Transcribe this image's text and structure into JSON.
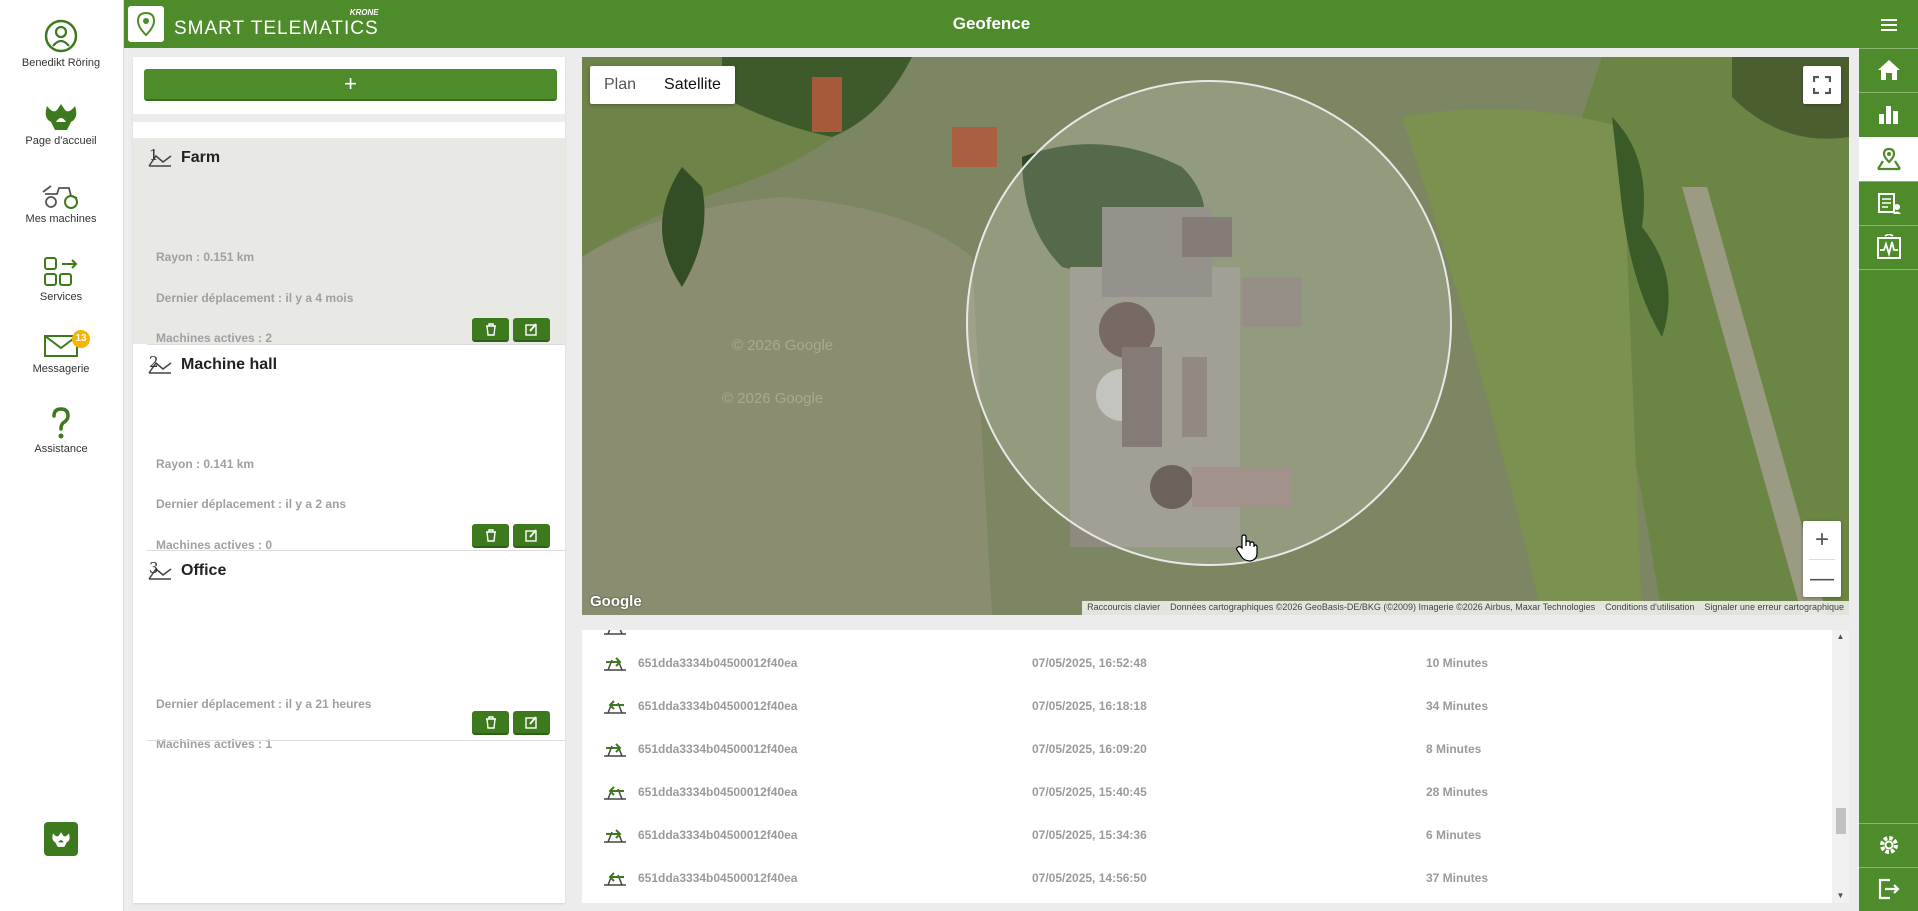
{
  "app": {
    "brand": "SMART TELEMATICS",
    "brand_maker": "KRONE",
    "page_title": "Geofence"
  },
  "sidebar": {
    "items": [
      {
        "label": "Benedikt Röring",
        "icon": "user-icon"
      },
      {
        "label": "Page d'accueil",
        "icon": "krone-logo-icon"
      },
      {
        "label": "Mes machines",
        "icon": "tractor-icon"
      },
      {
        "label": "Services",
        "icon": "services-icon"
      },
      {
        "label": "Messagerie",
        "icon": "envelope-icon",
        "badge": "13"
      },
      {
        "label": "Assistance",
        "icon": "question-icon"
      }
    ]
  },
  "rightbar": {
    "items": [
      "menu-icon",
      "home-icon",
      "chart-icon",
      "geofence-icon",
      "report-icon",
      "telemetry-icon",
      "gear-icon",
      "logout-icon"
    ],
    "active": "geofence-icon"
  },
  "geofences": {
    "add_label": "+",
    "items": [
      {
        "num": "1",
        "name": "Farm",
        "radius": "Rayon : 0.151 km",
        "last_move": "Dernier déplacement : il y a 4 mois",
        "active": "Machines actives : 2",
        "selected": true
      },
      {
        "num": "2",
        "name": "Machine hall",
        "radius": "Rayon : 0.141 km",
        "last_move": "Dernier déplacement : il y a 2 ans",
        "active": "Machines actives : 0",
        "selected": false
      },
      {
        "num": "3",
        "name": "Office",
        "radius": "",
        "last_move": "Dernier déplacement : il y a 21 heures",
        "active": "Machines actives : 1",
        "selected": false
      }
    ]
  },
  "map": {
    "type_plan": "Plan",
    "type_satellite": "Satellite",
    "selected_type": "Satellite",
    "zoom_in": "+",
    "zoom_out": "—",
    "logo": "Google",
    "watermark": "© 2026 Google",
    "attribution": {
      "shortcuts": "Raccourcis clavier",
      "data": "Données cartographiques ©2026 GeoBasis-DE/BKG (©2009) Imagerie ©2026 Airbus, Maxar Technologies",
      "terms": "Conditions d'utilisation",
      "report": "Signaler une erreur cartographique"
    }
  },
  "log": {
    "rows": [
      {
        "id": "651dda3334b04500012f40ea",
        "date": "07/05/2025, 16:52:48",
        "duration": "10 Minutes",
        "direction": "exit"
      },
      {
        "id": "651dda3334b04500012f40ea",
        "date": "07/05/2025, 16:18:18",
        "duration": "34 Minutes",
        "direction": "enter"
      },
      {
        "id": "651dda3334b04500012f40ea",
        "date": "07/05/2025, 16:09:20",
        "duration": "8 Minutes",
        "direction": "exit"
      },
      {
        "id": "651dda3334b04500012f40ea",
        "date": "07/05/2025, 15:40:45",
        "duration": "28 Minutes",
        "direction": "enter"
      },
      {
        "id": "651dda3334b04500012f40ea",
        "date": "07/05/2025, 15:34:36",
        "duration": "6 Minutes",
        "direction": "exit"
      },
      {
        "id": "651dda3334b04500012f40ea",
        "date": "07/05/2025, 14:56:50",
        "duration": "37 Minutes",
        "direction": "enter"
      }
    ]
  },
  "colors": {
    "brand_green": "#4e8b2a",
    "dark_green": "#3d7a1e",
    "badge": "#f4b400"
  }
}
